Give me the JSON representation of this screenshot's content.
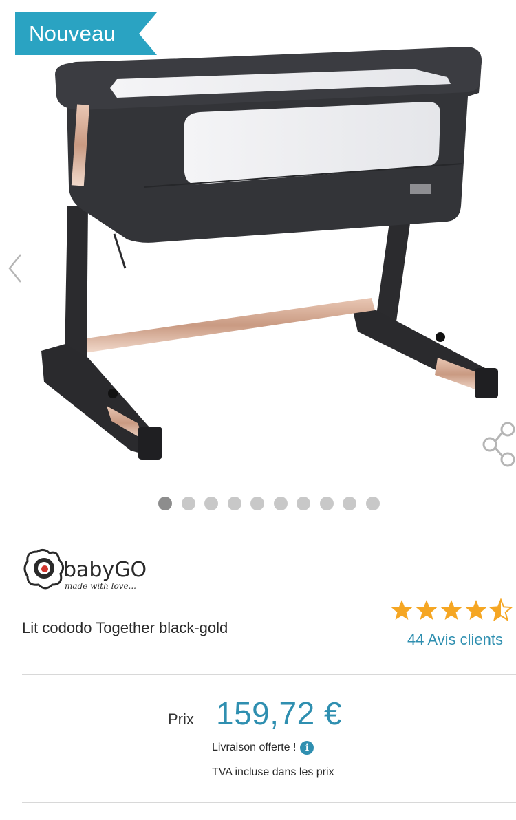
{
  "badge": {
    "label": "Nouveau",
    "color": "#2aa3c2"
  },
  "product": {
    "image_alt": "bedside-crib-black-gold",
    "title": "Lit cododo Together black-gold",
    "brand": {
      "name": "babyGO",
      "tagline": "made with love..."
    }
  },
  "carousel": {
    "total_images": 10,
    "active_index": 0,
    "prev_icon": "chevron-left-icon"
  },
  "share": {
    "icon": "share-icon"
  },
  "rating": {
    "value": 4.5,
    "max": 5,
    "star_color": "#f5a623",
    "reviews_label": "44 Avis clients"
  },
  "pricing": {
    "label": "Prix",
    "price": "159,72 €",
    "shipping": "Livraison offerte !",
    "vat": "TVA incluse dans les prix",
    "accent_color": "#2f8fb0"
  }
}
